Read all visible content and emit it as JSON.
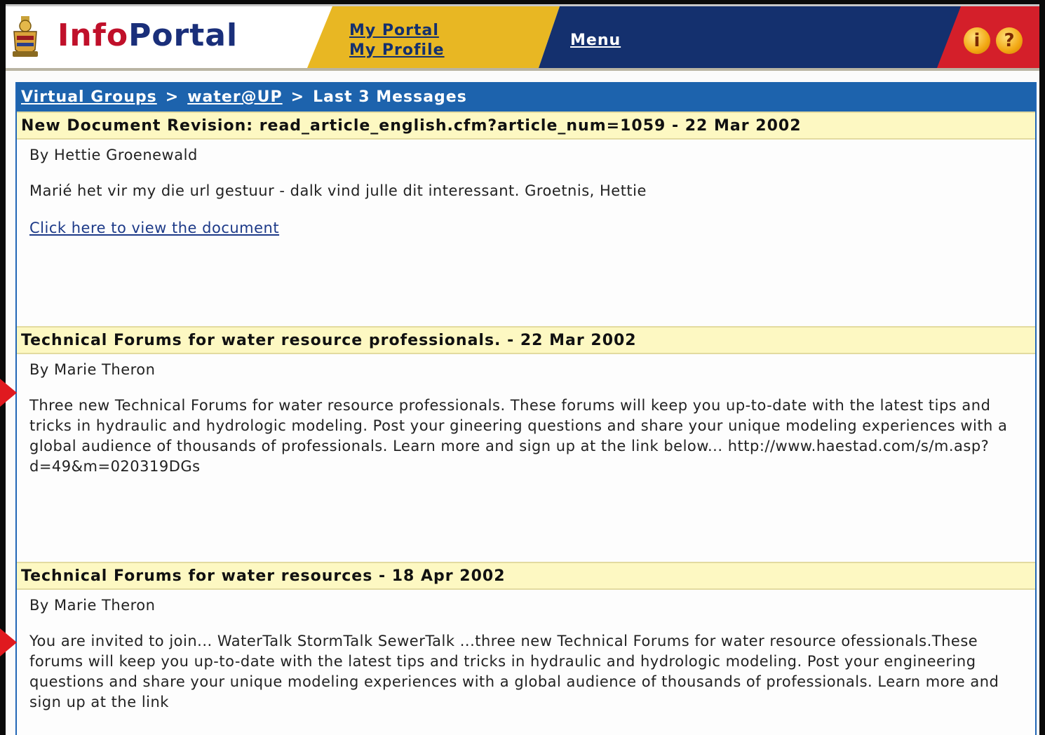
{
  "header": {
    "logo_part1": "Info",
    "logo_part2": "Portal",
    "my_portal": "My Portal",
    "my_profile": "My Profile",
    "menu": "Menu",
    "info_icon": "info-icon",
    "help_icon": "help-icon",
    "info_glyph": "i",
    "help_glyph": "?"
  },
  "breadcrumb": {
    "items": [
      "Virtual Groups",
      "water@UP",
      "Last 3 Messages"
    ],
    "separator": ">"
  },
  "messages": [
    {
      "title": "New Document Revision: read_article_english.cfm?article_num=1059 - 22 Mar 2002",
      "author": "By Hettie Groenewald",
      "text": "Marié het vir my die url gestuur - dalk vind julle dit interessant. Groetnis, Hettie",
      "link": "Click here to view the document"
    },
    {
      "title": "Technical Forums for water resource professionals. - 22 Mar 2002",
      "author": "By Marie Theron",
      "text": "Three new Technical Forums for water resource professionals. These forums will keep you up-to-date with the latest tips and tricks in hydraulic and hydrologic modeling. Post your gineering questions and share your unique modeling experiences with a global audience of thousands of professionals. Learn more and sign up at the link below... http://www.haestad.com/s/m.asp?d=49&m=020319DGs"
    },
    {
      "title": "Technical Forums for water resources - 18 Apr 2002",
      "author": "By Marie Theron",
      "text": "You are invited to join... WaterTalk StormTalk SewerTalk ...three new Technical Forums for water resource ofessionals.These forums will keep you up-to-date with the latest tips and tricks in hydraulic and hydrologic modeling. Post your engineering questions and share your unique modeling experiences with a global audience of thousands of professionals. Learn more and sign up at the link"
    }
  ],
  "colors": {
    "brand_red": "#c0102a",
    "brand_blue": "#1a2f7a",
    "header_gold": "#e8b723",
    "breadcrumb_blue": "#1d63ad",
    "title_yellow": "#fdf8c2"
  }
}
